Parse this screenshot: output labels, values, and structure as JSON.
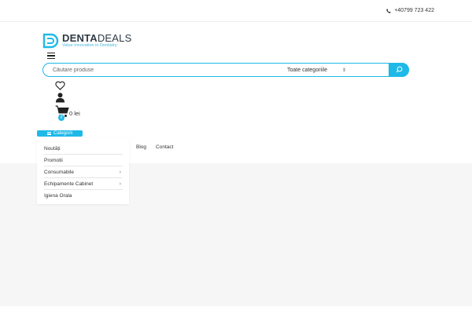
{
  "topbar": {
    "phone": "+40799 723 422"
  },
  "brand": {
    "name_bold": "DENTA",
    "name_light": "DEALS",
    "tagline": "Value Innovation in Dentistry",
    "accent_color": "#1fb9e8"
  },
  "search": {
    "placeholder": "Căutare produse",
    "category": "Toate categoriile"
  },
  "header_icons": [
    "heart-icon",
    "user-icon",
    "cart-icon"
  ],
  "cart": {
    "count": "0",
    "total": "0 lei"
  },
  "categories": {
    "button_label": "Categorii",
    "items": [
      {
        "label": "Noutăți",
        "has_sub": false
      },
      {
        "label": "Promotii",
        "has_sub": false
      },
      {
        "label": "Consumabile",
        "has_sub": true
      },
      {
        "label": "Echipamente Cabinet",
        "has_sub": true
      },
      {
        "label": "Igiena Orala",
        "has_sub": false
      }
    ]
  },
  "nav": {
    "items": [
      "Blog",
      "Contact"
    ]
  }
}
